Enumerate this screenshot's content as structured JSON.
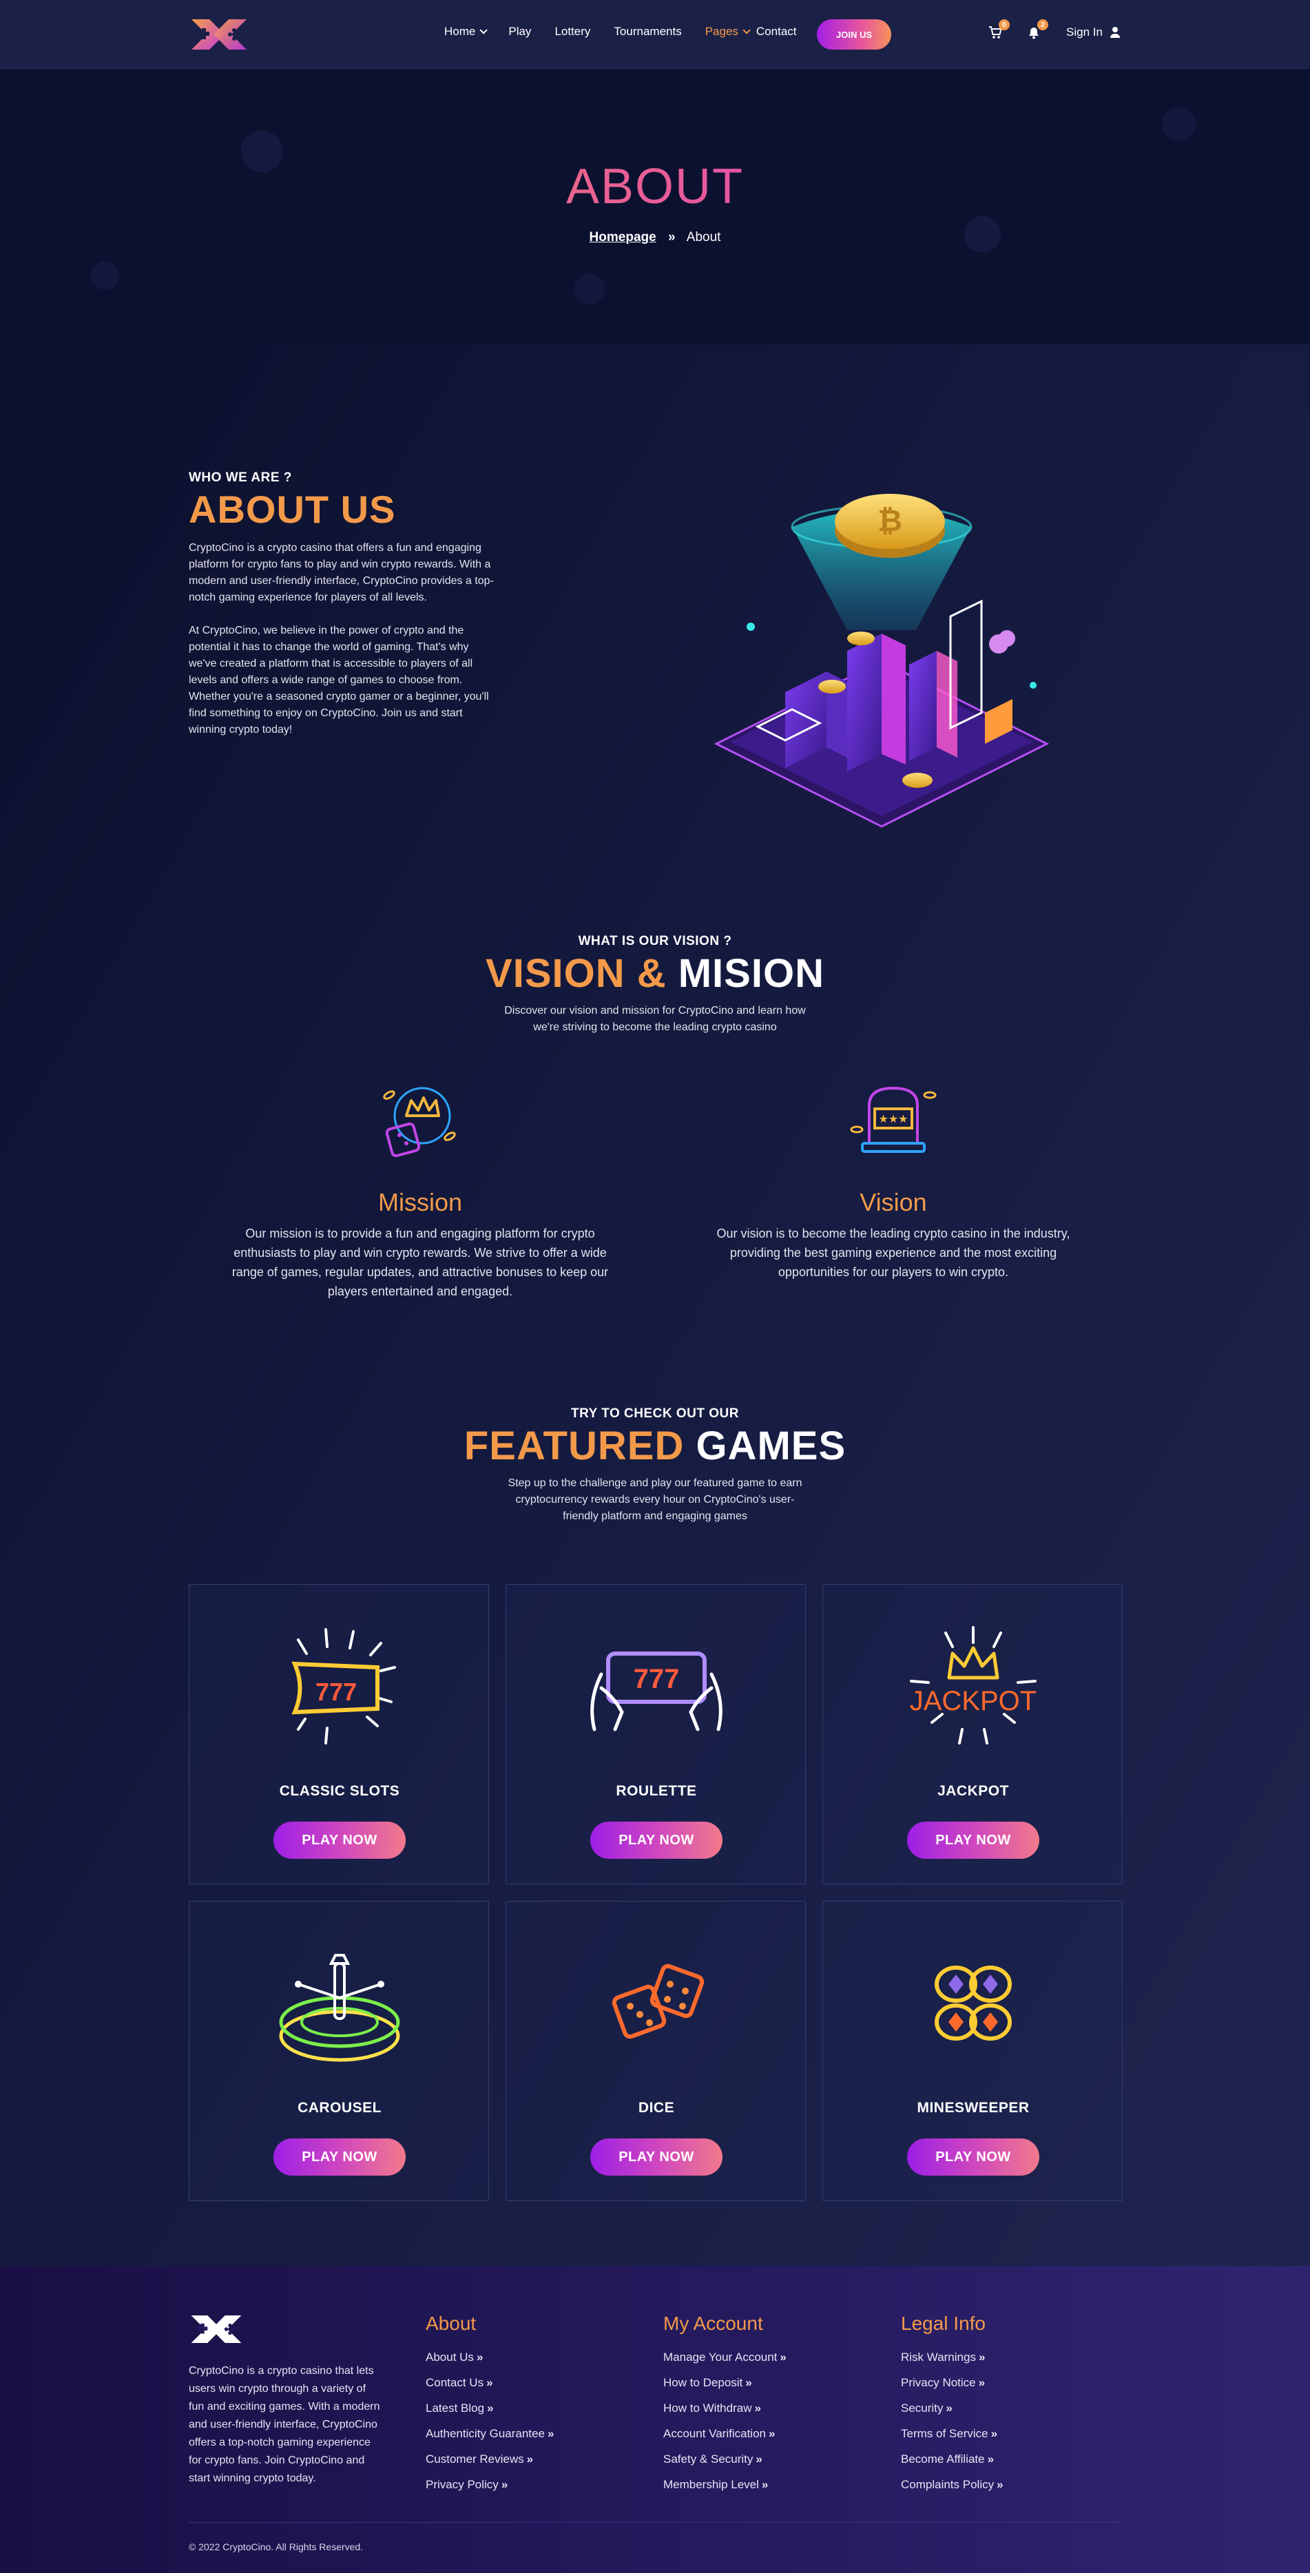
{
  "header": {
    "nav": [
      {
        "label": "Home",
        "dropdown": true,
        "active": false
      },
      {
        "label": "Play",
        "dropdown": false,
        "active": false
      },
      {
        "label": "Lottery",
        "dropdown": false,
        "active": false
      },
      {
        "label": "Tournaments",
        "dropdown": false,
        "active": false
      },
      {
        "label": "Pages",
        "dropdown": true,
        "active": true
      },
      {
        "label": "Contact",
        "dropdown": false,
        "active": false
      }
    ],
    "join_label": "JOIN US",
    "cart_count": "0",
    "notifications_count": "2",
    "signin_label": "Sign In",
    "icons": [
      "logo",
      "cart-icon",
      "bell-icon",
      "user-icon"
    ]
  },
  "banner": {
    "title": "ABOUT",
    "breadcrumb": {
      "home": "Homepage",
      "current": "About"
    }
  },
  "about": {
    "eyebrow": "WHO WE ARE ?",
    "title": "ABOUT US",
    "paragraphs": [
      "CryptoCino is a crypto casino that offers a fun and engaging platform for crypto fans to play and win crypto rewards. With a modern and user-friendly interface, CryptoCino provides a top-notch gaming experience for players of all levels.",
      "At CryptoCino, we believe in the power of crypto and the potential it has to change the world of gaming. That's why we've created a platform that is accessible to players of all levels and offers a wide range of games to choose from. Whether you're a seasoned crypto gamer or a beginner, you'll find something to enjoy on CryptoCino. Join us and start winning crypto today!"
    ]
  },
  "vision": {
    "eyebrow": "WHAT IS OUR VISION ?",
    "title_a": "VISION & ",
    "title_b": "MISION",
    "subtitle": "Discover our vision and mission for CryptoCino and learn how we're striving to become the leading crypto casino",
    "cards": [
      {
        "title": "Mission",
        "text": "Our mission is to provide a fun and engaging platform for crypto enthusiasts to play and win crypto rewards. We strive to offer a wide range of games, regular updates, and attractive bonuses to keep our players entertained and engaged."
      },
      {
        "title": "Vision",
        "text": "Our vision is to become the leading crypto casino in the industry, providing the best gaming experience and the most exciting opportunities for our players to win crypto."
      }
    ]
  },
  "games": {
    "eyebrow": "TRY TO CHECK OUT OUR",
    "title_a": "FEATURED ",
    "title_b": "GAMES",
    "subtitle": "Step up to the challenge and play our featured game to earn cryptocurrency rewards every hour on CryptoCino's user-friendly platform and engaging games",
    "play_label": "PLAY NOW",
    "items": [
      {
        "name": "CLASSIC SLOTS",
        "icon": "slot-machine-icon"
      },
      {
        "name": "ROULETTE",
        "icon": "phone-slots-icon"
      },
      {
        "name": "JACKPOT",
        "icon": "jackpot-crown-icon"
      },
      {
        "name": "CAROUSEL",
        "icon": "roulette-wheel-icon"
      },
      {
        "name": "DICE",
        "icon": "dice-icon"
      },
      {
        "name": "MINESWEEPER",
        "icon": "gems-icon"
      }
    ],
    "jackpot_text": "JACKPOT",
    "slot_digits": "777"
  },
  "footer": {
    "about_text": "CryptoCino is a crypto casino that lets users win crypto through a variety of fun and exciting games. With a modern and user-friendly interface, CryptoCino offers a top-notch gaming experience for crypto fans. Join CryptoCino and start winning crypto today.",
    "columns": [
      {
        "title": "About",
        "links": [
          "About Us",
          "Contact Us",
          "Latest Blog",
          "Authenticity Guarantee",
          "Customer Reviews",
          "Privacy Policy"
        ]
      },
      {
        "title": "My Account",
        "links": [
          "Manage Your Account",
          "How to Deposit",
          "How to Withdraw",
          "Account Varification",
          "Safety & Security",
          "Membership Level"
        ]
      },
      {
        "title": "Legal Info",
        "links": [
          "Risk Warnings",
          "Privacy Notice",
          "Security",
          "Terms of Service",
          "Become Affiliate",
          "Complaints Policy"
        ]
      }
    ],
    "copyright": "© 2022 CryptoCino. All Rights Reserved."
  },
  "colors": {
    "accent_orange": "#f39a4a",
    "accent_purple": "#a31fe4",
    "accent_pink": "#e7559d",
    "page_bg": "#141a3e",
    "footer_bg": "#24195c"
  }
}
